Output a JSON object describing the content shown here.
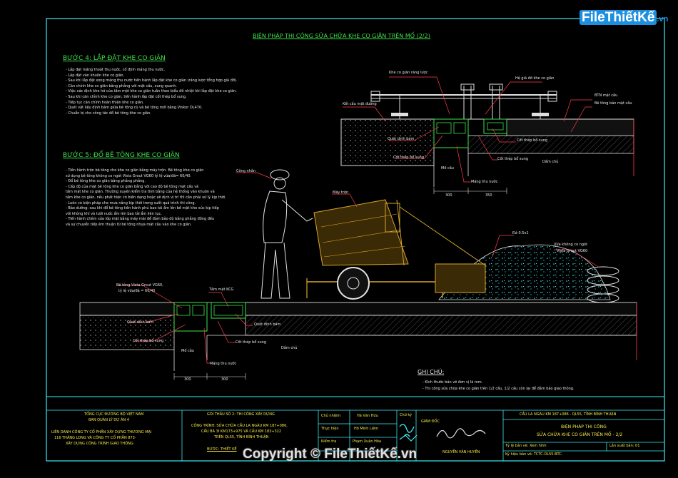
{
  "watermark": {
    "logo": "FileThiếtKế",
    "logo_tld": ".vn",
    "copyright": "Copyright © FileThiếtKế.vn"
  },
  "drawing": {
    "main_title": "BIỆN PHÁP THI CÔNG SỬA CHỮA KHE CO GIÃN TRÊN MỐ (2/2)",
    "step4": {
      "title": "BƯỚC 4: LẮP ĐẶT KHE CO GIÃN",
      "notes": [
        "- Lắp đặt máng thoát thu nước, cố định máng thu nước.",
        "- Lắp đặt ván khuôn khe co giãn.",
        "- Sau khi lắp đặt xong máng thu nước tiến hành lắp đặt khe co giãn (ráng lược tổng hợp giá đỡ).",
        "- Căn chỉnh khe co giãn bằng phẳng với mặt cầu, xung quanh.",
        "- Việc xác định khe hở của tấm một khe co giãn tuân theo biểu đồ nhiệt khi lắp đặt khe co giãn.",
        "- Sau khi căn chỉnh khe co giãn, tiến hành lắp đặt cốt thép bổ sung.",
        "- Tiếp tục căn chỉnh hoàn thiện khe co giãn.",
        "- Quét vật liệu định bám giữa bê tông cũ và bê tông mới bằng Vinkor DL470.",
        "- Chuẩn bị cho công tác đổ bê tông khe co giãn."
      ]
    },
    "step5": {
      "title": "BƯỚC 5: ĐỔ BÊ TÔNG KHE CO GIÃN",
      "notes": [
        "- Tiến hành trộn bê tông cho khe co giãn bằng máy trộn. Bê tông khe co giãn",
        "  sử dụng bê tông không co ngót Vista Grout VG60 tỷ lệ vữa/đá= 60/40.",
        "- Đổ bê tông khe co giãn bằng phẳng phẳng.",
        "- Cấp độ của mặt bê tông khe co giãn bằng với cao độ bê tông mặt cầu và",
        "  tấm mặt khe co giãn. Thường xuyên kiểm tra tính bằng của hệ thống ván khuôn và",
        "  tấm khe co giãn, nếu phát hiện có biến dạng hoặc xê dịch vị trí thì cần phải xử lý kịp thời.",
        "- Luôn có biện pháp che mưa nắng kịp thời trong suốt quá trình thi công.",
        "- Bảo dưỡng: sau khi đổ bê tông tiến hành phủ bao tải ẩm lên bề mặt khe xúc kịp tiếp",
        "  với không khí và tưới nước ẩm lên bao tải ẩm liên tục.",
        "- Tiến hành chêm sửa lớp mặt bằng máy mài để đảm bảo độ bằng phẳng đồng đều",
        "  và sự chuyển tiếp êm thuận từ bê tông nhựa mặt cầu vào khe co giãn."
      ]
    },
    "labels": {
      "gap_ctrl": "Khe co giãn răng lược",
      "support": "Hệ giá đỡ khe co giãn",
      "bitumen": "BTN mặt cầu",
      "deck_concrete": "Bê tông bản mặt cầu",
      "deck_structure": "Kết cấu mặt đường",
      "anchor1": "Quét dính bám",
      "rebar_add1": "Cốt thép bổ sung",
      "steel_add1": "Cốt thép bổ sung",
      "abut1": "Mố cầu",
      "slab1": "Dầm chủ",
      "drain1": "Máng thu nước",
      "dim_a": "300",
      "dim_b": "350",
      "worker": "Công nhân",
      "mixer": "Máy trộn",
      "aggregate": "Đá 0.5x1",
      "grout_bags": "Vữa không co ngót",
      "grout_name": "Vista Grout VG60",
      "concrete_vg": "Bê tông Vista Grout VG60,",
      "ratio": "tỷ lệ vữa/đá = 60/40",
      "formwork": "Tấm mặt KCG",
      "anchor2": "Quét dính bám",
      "anchor3": "Quét dính bám",
      "rebar2": "Cốt thép bổ sung",
      "rebar3": "Cốt thép bổ sung",
      "abut2": "Mố cầu",
      "slab2": "Dầm chủ",
      "drain2": "Máng thu nước",
      "dim_c": "300",
      "dim_d": "300"
    },
    "ghi_chu": {
      "title": "GHI CHÚ:",
      "lines": [
        "- Kích thước bản vẽ đơn vị là mm.",
        "- Thi công sửa chữa khe co giãn trên 1/2 cầu,  1/2 cầu còn lại để đảm bảo giao thông."
      ]
    }
  },
  "title_block": {
    "org": [
      "TỔNG CỤC ĐƯỜNG BỘ VIỆT NAM",
      "BAN QUẢN LÝ DỰ ÁN 4"
    ],
    "contractor": [
      "LIÊN DANH CÔNG TY CỔ PHẦN XÂY DỰNG THƯƠNG MẠI",
      "116 THĂNG LONG VÀ CÔNG TY CỔ PHẦN 873-",
      "XÂY DỰNG CÔNG TRÌNH GIAO THÔNG"
    ],
    "package": "GÓI THẦU SỐ 2: THI CÔNG XÂY DỰNG",
    "project": [
      "CÔNG TRÌNH: SỬA CHỮA CẦU LA NGÀU KM 187+086,",
      "CẦU BÁ 3I KM173+975 VÀ CẦU KM 183+322",
      "TRÊN QL55, TỈNH BÌNH THUẬN"
    ],
    "step": "BƯỚC: THIẾT KẾ",
    "roles": [
      {
        "role": "Chủ nhiệm",
        "name": "Hà Văn Hữu"
      },
      {
        "role": "Thực hiện",
        "name": "Hồ Minh Liêm"
      },
      {
        "role": "Kiểm tra",
        "name": "Phạm Xuân Hòa"
      }
    ],
    "signature_label": "Chữ ký",
    "director": "GIÁM ĐỐC",
    "director_name": "NGUYỄN VĂN HUYỀN",
    "bridge": "CẦU LA NGÀU KM 187+086 - QL55, TỈNH BÌNH THUẬN",
    "drawing_title": [
      "BIỆN PHÁP THI CÔNG",
      "SỬA CHỮA KHE CO GIÃN TRÊN MỐ - 2/2"
    ],
    "scale": "Tỷ lệ bản vẽ: Xem hình",
    "sheet": "Lần xuất bản: 01",
    "code": "Ký hiệu bản vẽ: TCTC-DL55-BTC-"
  }
}
